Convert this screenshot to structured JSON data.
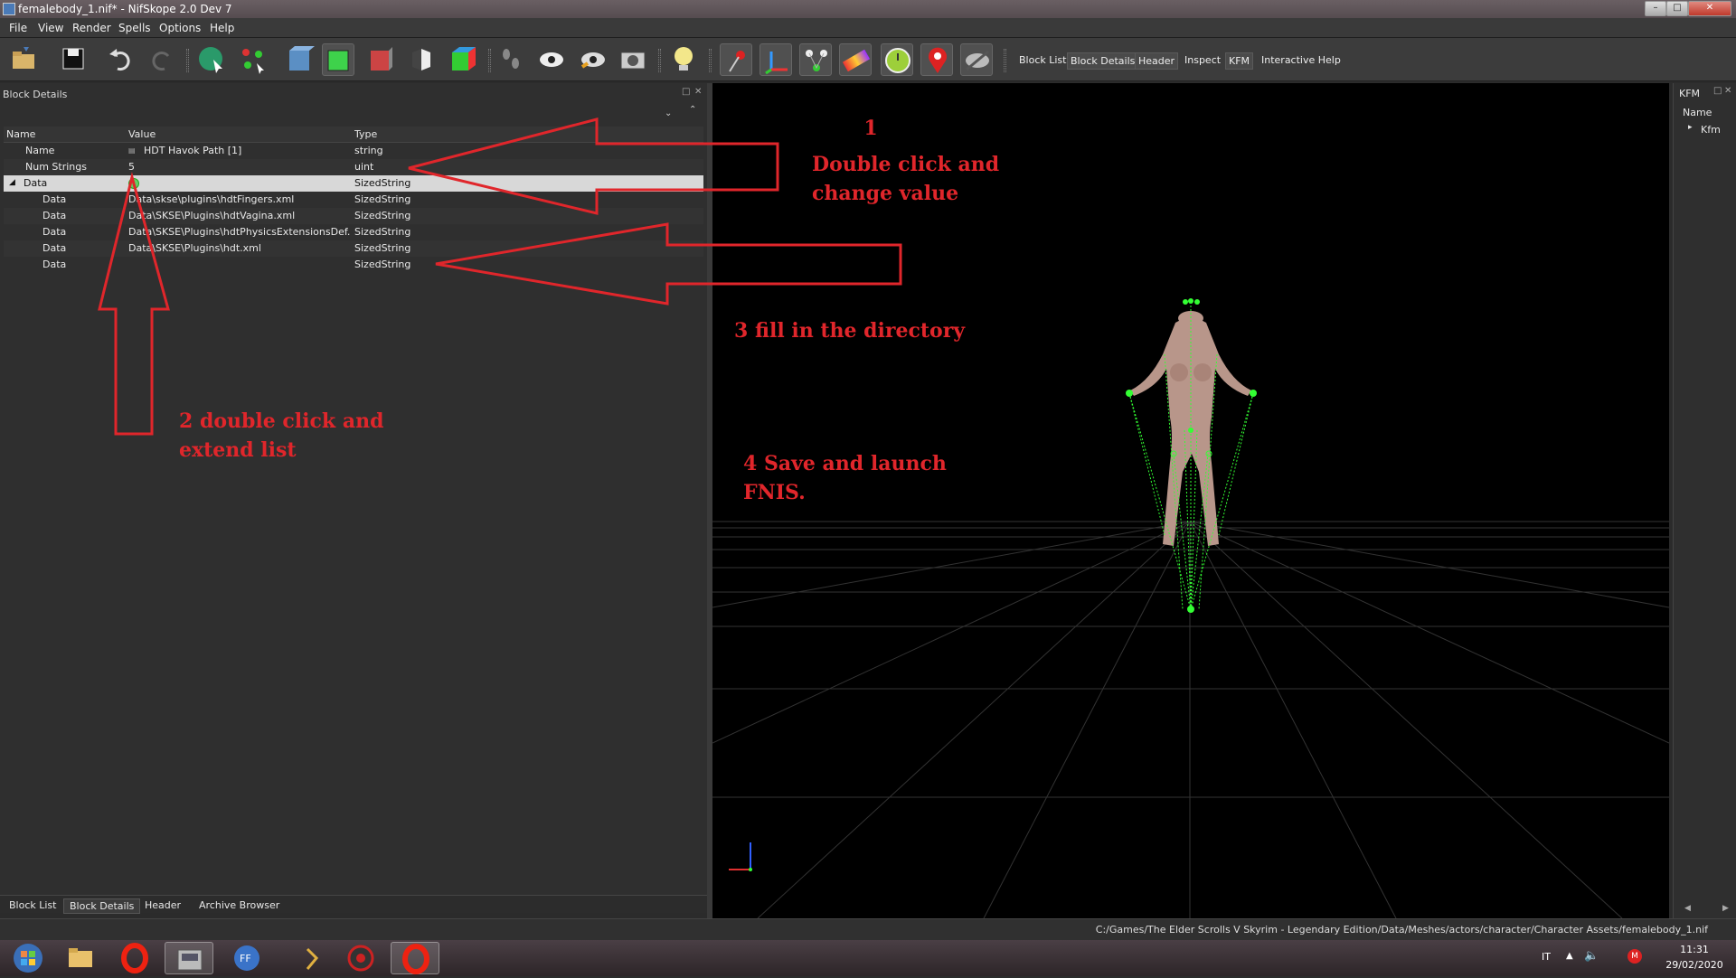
{
  "window": {
    "title": "femalebody_1.nif* - NifSkope 2.0 Dev 7",
    "buttons": [
      "–",
      "□",
      "✕"
    ]
  },
  "menu": [
    "File",
    "View",
    "Render",
    "Spells",
    "Options",
    "Help"
  ],
  "toolbar": {
    "text_buttons": [
      "Block List",
      "Block Details",
      "Header",
      "Inspect",
      "KFM",
      "Interactive Help"
    ]
  },
  "left_panel": {
    "title": "Block Details",
    "columns": [
      "Name",
      "Value",
      "Type"
    ],
    "rows": [
      {
        "name": "Name",
        "value": "HDT Havok Path [1]",
        "type": "string"
      },
      {
        "name": "Num Strings",
        "value": "5",
        "type": "uint"
      },
      {
        "name": "Data",
        "value": "",
        "type": "SizedString"
      },
      {
        "name": "Data",
        "value": "Data\\skse\\plugins\\hdtFingers.xml",
        "type": "SizedString"
      },
      {
        "name": "Data",
        "value": "Data\\SKSE\\Plugins\\hdtVagina.xml",
        "type": "SizedString"
      },
      {
        "name": "Data",
        "value": "Data\\SKSE\\Plugins\\hdtPhysicsExtensionsDef...",
        "type": "SizedString"
      },
      {
        "name": "Data",
        "value": "Data\\SKSE\\Plugins\\hdt.xml",
        "type": "SizedString"
      },
      {
        "name": "Data",
        "value": "",
        "type": "SizedString"
      }
    ],
    "tabs": [
      "Block List",
      "Block Details",
      "Header",
      "Archive Browser"
    ]
  },
  "right_panel": {
    "title": "KFM",
    "column": "Name",
    "item": "Kfm"
  },
  "annotations": {
    "step1": "1\nDouble click and\nchange value",
    "step2": "2 double click and\nextend list",
    "step3": "3 fill in the directory",
    "step4": "4 Save and launch\nFNIS."
  },
  "status_path": "C:/Games/The Elder Scrolls V Skyrim - Legendary Edition/Data/Meshes/actors/character/Character Assets/femalebody_1.nif",
  "taskbar": {
    "lang": "IT",
    "time": "11:31",
    "date": "29/02/2020"
  },
  "colors": {
    "annotation_red": "#e0262b",
    "bone_green": "#33ff33",
    "skin": "#b8968a"
  }
}
